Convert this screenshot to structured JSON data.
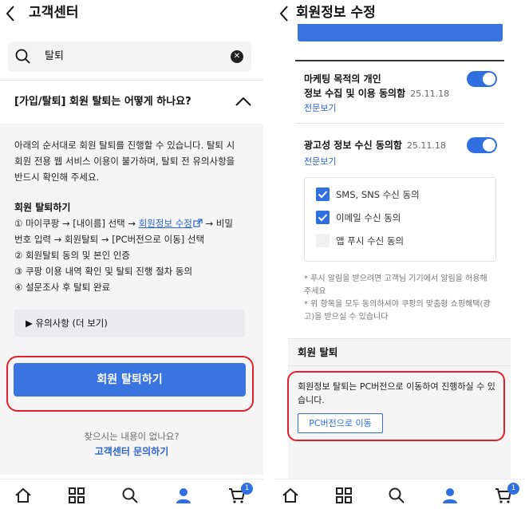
{
  "left": {
    "header": {
      "title": "고객센터"
    },
    "search": {
      "value": "탈퇴"
    },
    "faq": {
      "question": "[가입/탈퇴] 회원 탈퇴는 어떻게 하나요?",
      "answer_lines": [
        "아래의 순서대로 회원 탈퇴를 진행할 수 있습니다. 탈퇴 시",
        "회원 전용 웹 서비스 이용이 불가하며, 탈퇴 전 유의사항을",
        "반드시 확인해 주세요."
      ],
      "steps_title": "회원 탈퇴하기",
      "step1_prefix": "① 마이쿠팡 → [내이름] 선택 → ",
      "step1_link": "회원정보 수정",
      "step1_suffix": " → 비밀",
      "step1_cont": "번호 입력 → 회원탈퇴 → [PC버전으로 이동] 선택",
      "step2": "② 회원탈퇴 동의 및 본인 인증",
      "step3": "③ 쿠팡 이용 내역 확인 및 탈퇴 진행 절차 동의",
      "step4": "④ 설문조사 후 탈퇴 완료",
      "notes_toggle": "▶ 유의사항 (더 보기)"
    },
    "withdraw_button": "회원 탈퇴하기",
    "help_text": "찾으시는 내용이 없나요?",
    "help_link": "고객센터 문의하기",
    "cart_count": "1"
  },
  "right": {
    "header": {
      "title": "회원정보 수정"
    },
    "marketing": {
      "title_line1": "마케팅 목적의 개인",
      "title_line2": "정보 수집 및 이용 동의함",
      "date": "25.11.18",
      "link": "전문보기"
    },
    "ad_consent": {
      "title": "광고성 정보 수신 동의함",
      "date": "25.11.18",
      "link": "전문보기"
    },
    "channels": [
      {
        "label": "SMS, SNS 수신 동의",
        "checked": true
      },
      {
        "label": "이메일 수신 동의",
        "checked": true
      },
      {
        "label": "앱 푸시 수신 동의",
        "checked": false
      }
    ],
    "notes": [
      "* 푸시 알림을 받으려면 고객님 기기에서 알림을 허용해",
      "주세요",
      "* 위 항목을 모두 동의하셔야 쿠팡의 맞춤형 쇼핑혜택(광",
      "고)을 받으실 수 있습니다"
    ],
    "withdraw_section": {
      "title": "회원 탈퇴",
      "line1": "회원정보 탈퇴는 PC버전으로 이동하여 진행하실 수 있",
      "line2": "습니다.",
      "button": "PC버전으로 이동"
    },
    "cart_count": "1"
  },
  "colors": {
    "accent": "#3a74e0",
    "highlight": "#e0202a"
  },
  "icons": [
    "back-icon",
    "search-icon",
    "clear-icon",
    "chevron-up-icon",
    "external-link-icon",
    "home-icon",
    "category-icon",
    "search-tab-icon",
    "user-icon",
    "cart-icon"
  ]
}
